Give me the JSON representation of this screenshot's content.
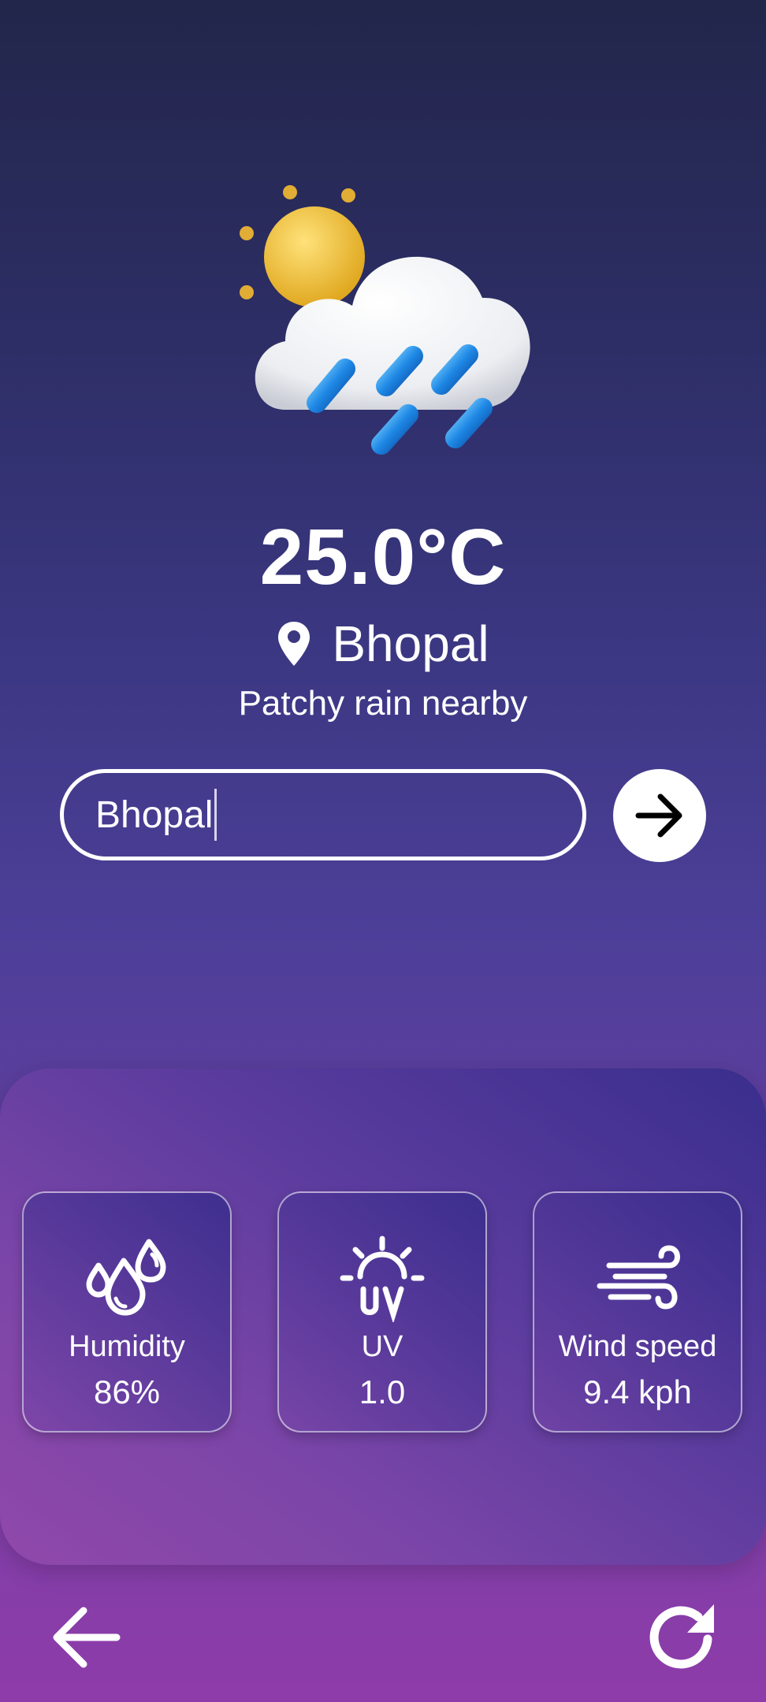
{
  "weather": {
    "icon": "sun-cloud-rain-icon",
    "temperature": "25.0°C",
    "location": "Bhopal",
    "condition": "Patchy rain nearby"
  },
  "search": {
    "value": "Bhopal",
    "submit_icon": "arrow-right-icon"
  },
  "stats": [
    {
      "icon": "water-drops-icon",
      "label": "Humidity",
      "value": "86%"
    },
    {
      "icon": "uv-sun-icon",
      "label": "UV",
      "value": "1.0"
    },
    {
      "icon": "wind-icon",
      "label": "Wind speed",
      "value": "9.4 kph"
    }
  ],
  "nav": {
    "back_icon": "arrow-left-icon",
    "refresh_icon": "refresh-icon"
  },
  "colors": {
    "background_top": "#22264a",
    "background_bottom": "#8e3ca9",
    "sun": "#f0c140",
    "rain": "#1e88e5"
  }
}
